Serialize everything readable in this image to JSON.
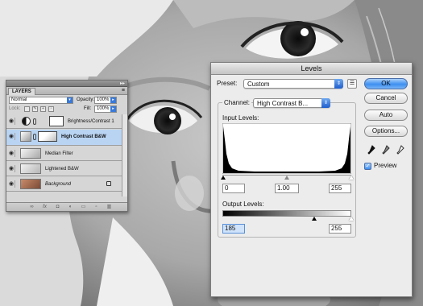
{
  "layers_panel": {
    "tab_label": "LAYERS",
    "blend_mode": "Normal",
    "opacity_label": "Opacity:",
    "opacity_value": "100%",
    "lock_label": "Lock:",
    "fill_label": "Fill:",
    "fill_value": "100%",
    "layers": [
      {
        "name": "Brightness/Contrast 1",
        "kind": "adjustment",
        "active": false
      },
      {
        "name": "High Contrast B&W",
        "kind": "adjustment-levels",
        "active": true
      },
      {
        "name": "Median Filter",
        "kind": "pixel",
        "active": false
      },
      {
        "name": "Lightened B&W",
        "kind": "pixel",
        "active": false
      },
      {
        "name": "Background",
        "kind": "background",
        "active": false
      }
    ]
  },
  "levels_dialog": {
    "title": "Levels",
    "preset_label": "Preset:",
    "preset_value": "Custom",
    "channel_label": "Channel:",
    "channel_value": "High Contrast B...",
    "input_levels_label": "Input Levels:",
    "input_black": "0",
    "input_gamma": "1.00",
    "input_white": "255",
    "output_levels_label": "Output Levels:",
    "output_black": "185",
    "output_white": "255",
    "buttons": {
      "ok": "OK",
      "cancel": "Cancel",
      "auto": "Auto",
      "options": "Options..."
    },
    "preview_label": "Preview",
    "preview_checked": true
  }
}
